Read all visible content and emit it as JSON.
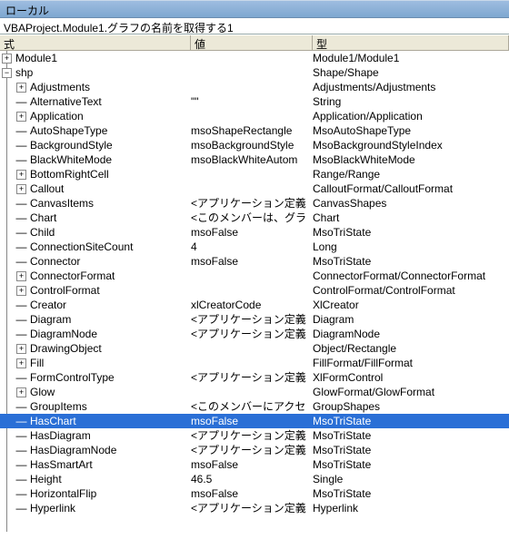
{
  "window": {
    "title": "ローカル",
    "path": "VBAProject.Module1.グラフの名前を取得する1"
  },
  "headers": {
    "expr": "式",
    "value": "値",
    "type": "型"
  },
  "rows": [
    {
      "name": "Module1",
      "value": "",
      "type": "Module1/Module1",
      "indent": 0,
      "exp": "collapsed"
    },
    {
      "name": "shp",
      "value": "",
      "type": "Shape/Shape",
      "indent": 0,
      "exp": "expanded"
    },
    {
      "name": "Adjustments",
      "value": "",
      "type": "Adjustments/Adjustments",
      "indent": 1,
      "exp": "collapsed"
    },
    {
      "name": "AlternativeText",
      "value": "\"\"",
      "type": "String",
      "indent": 1,
      "exp": "none"
    },
    {
      "name": "Application",
      "value": "",
      "type": "Application/Application",
      "indent": 1,
      "exp": "collapsed"
    },
    {
      "name": "AutoShapeType",
      "value": "msoShapeRectangle",
      "type": "MsoAutoShapeType",
      "indent": 1,
      "exp": "none"
    },
    {
      "name": "BackgroundStyle",
      "value": "msoBackgroundStyle",
      "type": "MsoBackgroundStyleIndex",
      "indent": 1,
      "exp": "none"
    },
    {
      "name": "BlackWhiteMode",
      "value": "msoBlackWhiteAutom",
      "type": "MsoBlackWhiteMode",
      "indent": 1,
      "exp": "none"
    },
    {
      "name": "BottomRightCell",
      "value": "",
      "type": "Range/Range",
      "indent": 1,
      "exp": "collapsed"
    },
    {
      "name": "Callout",
      "value": "",
      "type": "CalloutFormat/CalloutFormat",
      "indent": 1,
      "exp": "collapsed"
    },
    {
      "name": "CanvasItems",
      "value": "<アプリケーション定義",
      "type": "CanvasShapes",
      "indent": 1,
      "exp": "none"
    },
    {
      "name": "Chart",
      "value": "<このメンバーは、グラ",
      "type": "Chart",
      "indent": 1,
      "exp": "none"
    },
    {
      "name": "Child",
      "value": "msoFalse",
      "type": "MsoTriState",
      "indent": 1,
      "exp": "none"
    },
    {
      "name": "ConnectionSiteCount",
      "value": "4",
      "type": "Long",
      "indent": 1,
      "exp": "none"
    },
    {
      "name": "Connector",
      "value": "msoFalse",
      "type": "MsoTriState",
      "indent": 1,
      "exp": "none"
    },
    {
      "name": "ConnectorFormat",
      "value": "",
      "type": "ConnectorFormat/ConnectorFormat",
      "indent": 1,
      "exp": "collapsed"
    },
    {
      "name": "ControlFormat",
      "value": "",
      "type": "ControlFormat/ControlFormat",
      "indent": 1,
      "exp": "collapsed"
    },
    {
      "name": "Creator",
      "value": "xlCreatorCode",
      "type": "XlCreator",
      "indent": 1,
      "exp": "none"
    },
    {
      "name": "Diagram",
      "value": "<アプリケーション定義",
      "type": "Diagram",
      "indent": 1,
      "exp": "none"
    },
    {
      "name": "DiagramNode",
      "value": "<アプリケーション定義",
      "type": "DiagramNode",
      "indent": 1,
      "exp": "none"
    },
    {
      "name": "DrawingObject",
      "value": "",
      "type": "Object/Rectangle",
      "indent": 1,
      "exp": "collapsed"
    },
    {
      "name": "Fill",
      "value": "",
      "type": "FillFormat/FillFormat",
      "indent": 1,
      "exp": "collapsed"
    },
    {
      "name": "FormControlType",
      "value": "<アプリケーション定義",
      "type": "XlFormControl",
      "indent": 1,
      "exp": "none"
    },
    {
      "name": "Glow",
      "value": "",
      "type": "GlowFormat/GlowFormat",
      "indent": 1,
      "exp": "collapsed"
    },
    {
      "name": "GroupItems",
      "value": "<このメンバーにアクセ",
      "type": "GroupShapes",
      "indent": 1,
      "exp": "none"
    },
    {
      "name": "HasChart",
      "value": "msoFalse",
      "type": "MsoTriState",
      "indent": 1,
      "exp": "none",
      "selected": true
    },
    {
      "name": "HasDiagram",
      "value": "<アプリケーション定義",
      "type": "MsoTriState",
      "indent": 1,
      "exp": "none"
    },
    {
      "name": "HasDiagramNode",
      "value": "<アプリケーション定義",
      "type": "MsoTriState",
      "indent": 1,
      "exp": "none"
    },
    {
      "name": "HasSmartArt",
      "value": "msoFalse",
      "type": "MsoTriState",
      "indent": 1,
      "exp": "none"
    },
    {
      "name": "Height",
      "value": "46.5",
      "type": "Single",
      "indent": 1,
      "exp": "none"
    },
    {
      "name": "HorizontalFlip",
      "value": "msoFalse",
      "type": "MsoTriState",
      "indent": 1,
      "exp": "none"
    },
    {
      "name": "Hyperlink",
      "value": "<アプリケーション定義",
      "type": "Hyperlink",
      "indent": 1,
      "exp": "none"
    }
  ]
}
